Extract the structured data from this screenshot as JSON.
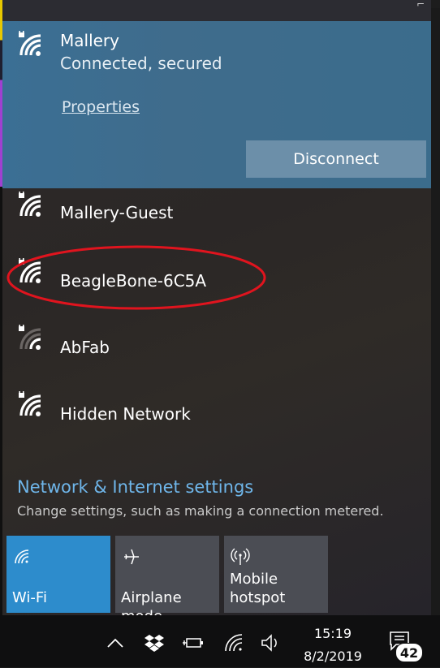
{
  "networks": {
    "connected": {
      "name": "Mallery",
      "status": "Connected, secured",
      "properties_label": "Properties",
      "disconnect_label": "Disconnect"
    },
    "list": [
      {
        "name": "Mallery-Guest"
      },
      {
        "name": "BeagleBone-6C5A"
      },
      {
        "name": "AbFab"
      },
      {
        "name": "Hidden Network"
      }
    ]
  },
  "settings": {
    "link_label": "Network & Internet settings",
    "subtext": "Change settings, such as making a connection metered."
  },
  "quick_actions": [
    {
      "label_line1": "Wi-Fi",
      "label_line2": "",
      "icon": "wifi-icon",
      "active": true
    },
    {
      "label_line1": "Airplane mode",
      "label_line2": "",
      "icon": "airplane-icon",
      "active": false
    },
    {
      "label_line1": "Mobile",
      "label_line2": "hotspot",
      "icon": "hotspot-icon",
      "active": false
    }
  ],
  "taskbar": {
    "time": "15:19",
    "date": "8/2/2019",
    "notification_count": "42",
    "icons": [
      "chevron-up-icon",
      "dropbox-icon",
      "power-icon",
      "wifi-icon",
      "volume-icon",
      "action-center-icon"
    ]
  },
  "colors": {
    "accent": "#2d8ccc",
    "connected_bg": "#3b6f94",
    "link": "#6fb6ea",
    "highlight_ellipse": "#e0141e"
  }
}
